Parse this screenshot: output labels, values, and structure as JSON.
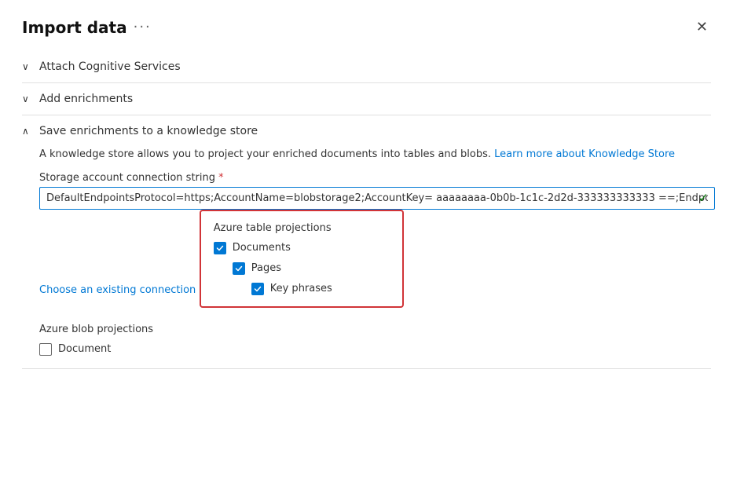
{
  "panel": {
    "title": "Import data",
    "ellipsis": "···",
    "close_label": "✕"
  },
  "sections": {
    "cognitive_services": {
      "label": "Attach Cognitive Services",
      "expanded": false
    },
    "add_enrichments": {
      "label": "Add enrichments",
      "expanded": false
    },
    "knowledge_store": {
      "label": "Save enrichments to a knowledge store",
      "expanded": true
    }
  },
  "knowledge_store": {
    "description_part1": "A knowledge store allows you to project your enriched documents into tables and blobs.",
    "description_link_text": "Learn more about Knowledge Store",
    "field_label": "Storage account connection string",
    "required_marker": " *",
    "connection_value": "DefaultEndpointsProtocol=https;AccountName=blobstorage2;AccountKey= aaaaaaaa-0b0b-1c1c-2d2d-333333333333 ==;EndpointSu",
    "choose_connection_label": "Choose an existing connection",
    "azure_table_title": "Azure table projections",
    "checkboxes": {
      "documents": {
        "label": "Documents",
        "checked": true
      },
      "pages": {
        "label": "Pages",
        "checked": true
      },
      "key_phrases": {
        "label": "Key phrases",
        "checked": true
      }
    },
    "azure_blob_title": "Azure blob projections",
    "blob_checkboxes": {
      "document": {
        "label": "Document",
        "checked": false
      }
    }
  }
}
